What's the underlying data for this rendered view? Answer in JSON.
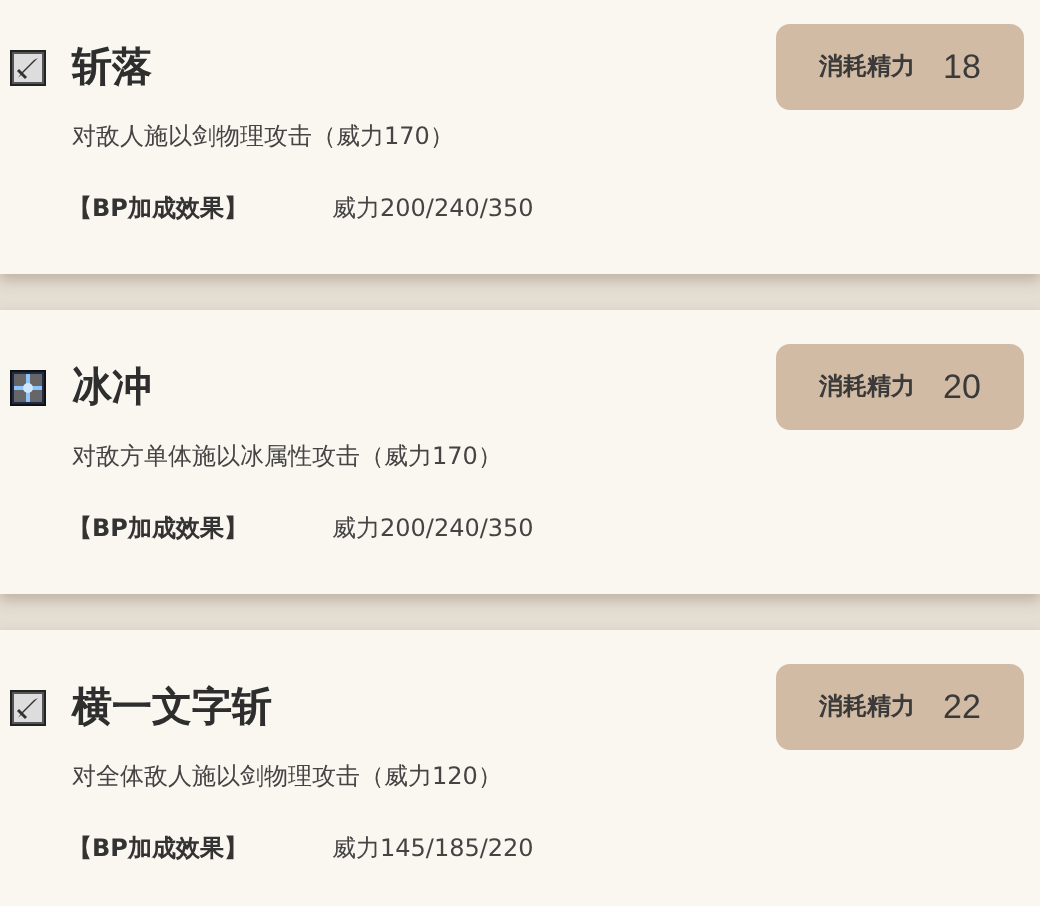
{
  "skills": [
    {
      "kind": "physical",
      "name": "斩落",
      "cost_label": "消耗精力",
      "cost": "18",
      "description": "对敌人施以剑物理攻击（威力170）",
      "bp_label": "【BP加成效果】",
      "bp_effect": "威力200/240/350"
    },
    {
      "kind": "elemental",
      "name": "冰冲",
      "cost_label": "消耗精力",
      "cost": "20",
      "description": "对敌方单体施以冰属性攻击（威力170）",
      "bp_label": "【BP加成效果】",
      "bp_effect": "威力200/240/350"
    },
    {
      "kind": "physical",
      "name": "横一文字斩",
      "cost_label": "消耗精力",
      "cost": "22",
      "description": "对全体敌人施以剑物理攻击（威力120）",
      "bp_label": "【BP加成效果】",
      "bp_effect": "威力145/185/220"
    }
  ]
}
